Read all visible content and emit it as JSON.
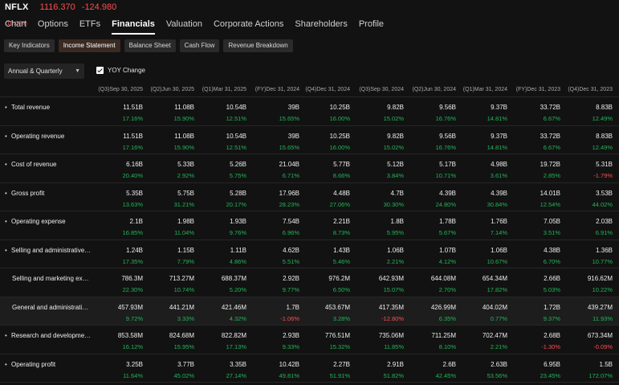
{
  "header": {
    "ticker": "NFLX",
    "price": "1116.370",
    "change": "-124.980",
    "change_pct": "-10.07%"
  },
  "tabs": [
    {
      "label": "Chart",
      "active": false
    },
    {
      "label": "Options",
      "active": false
    },
    {
      "label": "ETFs",
      "active": false
    },
    {
      "label": "Financials",
      "active": true
    },
    {
      "label": "Valuation",
      "active": false
    },
    {
      "label": "Corporate Actions",
      "active": false
    },
    {
      "label": "Shareholders",
      "active": false
    },
    {
      "label": "Profile",
      "active": false
    }
  ],
  "subtabs": [
    {
      "label": "Key Indicators",
      "active": false
    },
    {
      "label": "Income Statement",
      "active": true
    },
    {
      "label": "Balance Sheet",
      "active": false
    },
    {
      "label": "Cash Flow",
      "active": false
    },
    {
      "label": "Revenue Breakdown",
      "active": false
    }
  ],
  "period_select": {
    "value": "Annual & Quarterly"
  },
  "yoy": {
    "label": "YOY Change",
    "checked": true
  },
  "columns": [
    "(Q3)Sep 30, 2025",
    "(Q2)Jun 30, 2025",
    "(Q1)Mar 31, 2025",
    "(FY)Dec 31, 2024",
    "(Q4)Dec 31, 2024",
    "(Q3)Sep 30, 2024",
    "(Q2)Jun 30, 2024",
    "(Q1)Mar 31, 2024",
    "(FY)Dec 31, 2023",
    "(Q4)Dec 31, 2023"
  ],
  "rows": [
    {
      "label": "Total revenue",
      "bullet": true,
      "sub": false,
      "highlight": false,
      "values": [
        "11.51B",
        "11.08B",
        "10.54B",
        "39B",
        "10.25B",
        "9.82B",
        "9.56B",
        "9.37B",
        "33.72B",
        "8.83B"
      ],
      "changes": [
        "17.16%",
        "15.90%",
        "12.51%",
        "15.65%",
        "16.00%",
        "15.02%",
        "16.76%",
        "14.81%",
        "6.67%",
        "12.49%"
      ]
    },
    {
      "label": "Operating revenue",
      "bullet": true,
      "sub": false,
      "highlight": false,
      "values": [
        "11.51B",
        "11.08B",
        "10.54B",
        "39B",
        "10.25B",
        "9.82B",
        "9.56B",
        "9.37B",
        "33.72B",
        "8.83B"
      ],
      "changes": [
        "17.16%",
        "15.90%",
        "12.51%",
        "15.65%",
        "16.00%",
        "15.02%",
        "16.76%",
        "14.81%",
        "6.67%",
        "12.49%"
      ]
    },
    {
      "label": "Cost of revenue",
      "bullet": true,
      "sub": false,
      "highlight": false,
      "values": [
        "6.16B",
        "5.33B",
        "5.26B",
        "21.04B",
        "5.77B",
        "5.12B",
        "5.17B",
        "4.98B",
        "19.72B",
        "5.31B"
      ],
      "changes": [
        "20.40%",
        "2.92%",
        "5.75%",
        "6.71%",
        "8.66%",
        "3.84%",
        "10.71%",
        "3.61%",
        "2.85%",
        "-1.79%"
      ]
    },
    {
      "label": "Gross profit",
      "bullet": true,
      "sub": false,
      "highlight": false,
      "values": [
        "5.35B",
        "5.75B",
        "5.28B",
        "17.96B",
        "4.48B",
        "4.7B",
        "4.39B",
        "4.39B",
        "14.01B",
        "3.53B"
      ],
      "changes": [
        "13.63%",
        "31.21%",
        "20.17%",
        "28.23%",
        "27.06%",
        "30.30%",
        "24.80%",
        "30.84%",
        "12.54%",
        "44.02%"
      ]
    },
    {
      "label": "Operating expense",
      "bullet": true,
      "sub": false,
      "highlight": false,
      "values": [
        "2.1B",
        "1.98B",
        "1.93B",
        "7.54B",
        "2.21B",
        "1.8B",
        "1.78B",
        "1.76B",
        "7.05B",
        "2.03B"
      ],
      "changes": [
        "16.85%",
        "11.04%",
        "9.76%",
        "6.96%",
        "8.73%",
        "5.95%",
        "5.67%",
        "7.14%",
        "3.51%",
        "6.91%"
      ]
    },
    {
      "label": "Selling and administrative e...",
      "bullet": true,
      "sub": false,
      "highlight": false,
      "values": [
        "1.24B",
        "1.15B",
        "1.11B",
        "4.62B",
        "1.43B",
        "1.06B",
        "1.07B",
        "1.06B",
        "4.38B",
        "1.36B"
      ],
      "changes": [
        "17.35%",
        "7.79%",
        "4.86%",
        "5.51%",
        "5.46%",
        "2.21%",
        "4.12%",
        "10.67%",
        "6.70%",
        "10.77%"
      ]
    },
    {
      "label": "Selling and marketing expe...",
      "bullet": false,
      "sub": true,
      "highlight": false,
      "values": [
        "786.3M",
        "713.27M",
        "688.37M",
        "2.92B",
        "976.2M",
        "642.93M",
        "644.08M",
        "654.34M",
        "2.66B",
        "916.62M"
      ],
      "changes": [
        "22.30%",
        "10.74%",
        "5.20%",
        "9.77%",
        "6.50%",
        "15.07%",
        "2.70%",
        "17.82%",
        "5.03%",
        "10.22%"
      ]
    },
    {
      "label": "General and administrative ...",
      "bullet": false,
      "sub": true,
      "highlight": true,
      "values": [
        "457.93M",
        "441.21M",
        "421.46M",
        "1.7B",
        "453.67M",
        "417.35M",
        "426.99M",
        "404.02M",
        "1.72B",
        "439.27M"
      ],
      "changes": [
        "9.72%",
        "3.33%",
        "4.32%",
        "-1.06%",
        "3.28%",
        "-12.80%",
        "6.35%",
        "0.77%",
        "9.37%",
        "11.93%"
      ]
    },
    {
      "label": "Research and development ...",
      "bullet": true,
      "sub": false,
      "highlight": false,
      "values": [
        "853.58M",
        "824.68M",
        "822.82M",
        "2.93B",
        "776.51M",
        "735.06M",
        "711.25M",
        "702.47M",
        "2.68B",
        "673.34M"
      ],
      "changes": [
        "16.12%",
        "15.95%",
        "17.13%",
        "9.33%",
        "15.32%",
        "11.85%",
        "8.10%",
        "2.21%",
        "-1.30%",
        "-0.09%"
      ]
    },
    {
      "label": "Operating profit",
      "bullet": true,
      "sub": false,
      "highlight": false,
      "values": [
        "3.25B",
        "3.77B",
        "3.35B",
        "10.42B",
        "2.27B",
        "2.91B",
        "2.6B",
        "2.63B",
        "6.95B",
        "1.5B"
      ],
      "changes": [
        "11.64%",
        "45.02%",
        "27.14%",
        "49.81%",
        "51.91%",
        "51.82%",
        "42.45%",
        "53.56%",
        "23.45%",
        "172.07%"
      ]
    }
  ]
}
